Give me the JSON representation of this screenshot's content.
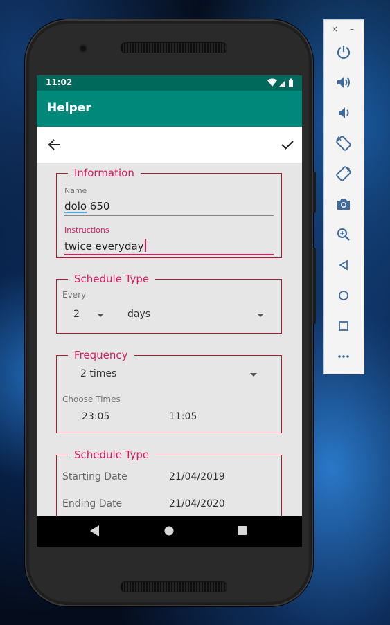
{
  "status_bar": {
    "time": "11:02"
  },
  "app_bar": {
    "title": "Helper"
  },
  "information": {
    "legend": "Information",
    "name_label": "Name",
    "name_value": "dolo 650",
    "instructions_label": "Instructions",
    "instructions_value": "twice everyday"
  },
  "schedule": {
    "legend": "Schedule Type",
    "every_label": "Every",
    "every_value": "2",
    "unit_value": "days"
  },
  "frequency": {
    "legend": "Frequency",
    "times_value": "2 times",
    "choose_times_label": "Choose Times",
    "time_1": "23:05",
    "time_2": "11:05"
  },
  "dates": {
    "legend": "Schedule Type",
    "start_label": "Starting Date",
    "start_value": "21/04/2019",
    "end_label": "Ending Date",
    "end_value": "21/04/2020"
  },
  "emulator_panel": {
    "close_label": "×",
    "minimize_label": "–",
    "buttons": [
      "power",
      "volume-up",
      "volume-down",
      "rotate-left",
      "rotate-right",
      "screenshot",
      "zoom",
      "back",
      "home",
      "overview",
      "more"
    ]
  },
  "colors": {
    "status_bar": "#00695c",
    "app_bar": "#00897b",
    "accent": "#d81b60",
    "fieldset_border": "#b01b2e",
    "content_bg": "#e6e6e6"
  }
}
